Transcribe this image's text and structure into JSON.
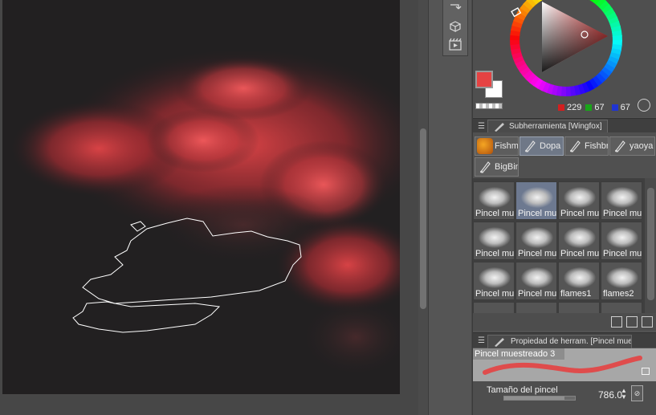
{
  "colors": {
    "main": "#e54343",
    "sub": "#ffffff",
    "accent_red": "#e54343",
    "selected_bg": "#6f7887"
  },
  "color_panel": {
    "r": "229",
    "g": "67",
    "b": "67"
  },
  "tool_column": {
    "icons": [
      "layer-move-icon",
      "3d-cube-icon",
      "animation-icon"
    ]
  },
  "subtool": {
    "header": "Subherramienta [Wingfox]",
    "tools": [
      {
        "label": "Fishm",
        "icon": "fish-brush-icon",
        "selected": false
      },
      {
        "label": "Dopa",
        "icon": "pen-icon",
        "selected": true
      },
      {
        "label": "Fishbr",
        "icon": "pen-icon",
        "selected": false
      },
      {
        "label": "yaoya",
        "icon": "pen-icon",
        "selected": false
      },
      {
        "label": "BigBin",
        "icon": "pen-icon",
        "selected": false
      }
    ],
    "brushes": [
      {
        "label": "Pincel mue",
        "selected": false
      },
      {
        "label": "Pincel mue",
        "selected": true
      },
      {
        "label": "Pincel mue",
        "selected": false
      },
      {
        "label": "Pincel mue",
        "selected": false
      },
      {
        "label": "Pincel mue",
        "selected": false
      },
      {
        "label": "Pincel mue",
        "selected": false
      },
      {
        "label": "Pincel mue",
        "selected": false
      },
      {
        "label": "Pincel mue",
        "selected": false
      },
      {
        "label": "Pincel mue",
        "selected": false
      },
      {
        "label": "Pincel mue",
        "selected": false
      },
      {
        "label": "flames1",
        "selected": false
      },
      {
        "label": "flames2",
        "selected": false
      }
    ]
  },
  "tool_property": {
    "header": "Propiedad de herram. [Pincel mue",
    "brush_name": "Pincel muestreado 3",
    "size_label": "Tamaño del pincel",
    "size_value": "786.0",
    "size_fraction": 0.85
  }
}
